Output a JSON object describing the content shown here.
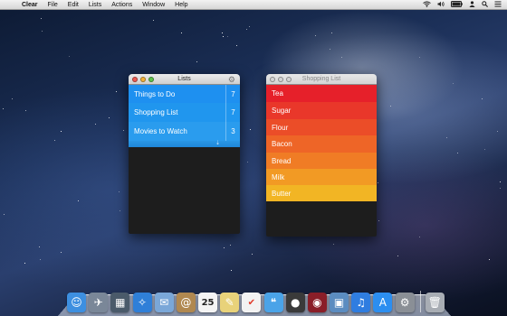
{
  "menubar": {
    "apple_icon": "apple-icon",
    "app_name": "Clear",
    "menus": [
      "File",
      "Edit",
      "Lists",
      "Actions",
      "Window",
      "Help"
    ],
    "status_icons": [
      "wifi-icon",
      "volume-icon",
      "battery-icon",
      "user-icon",
      "search-icon",
      "list-icon"
    ]
  },
  "lists_window": {
    "title": "Lists",
    "items": [
      {
        "label": "Things to Do",
        "count": "7",
        "color": "#1e90f0"
      },
      {
        "label": "Shopping List",
        "count": "7",
        "color": "#2096ee"
      },
      {
        "label": "Movies to Watch",
        "count": "3",
        "color": "#2a9cee"
      }
    ]
  },
  "shopping_window": {
    "title": "Shopping List",
    "items": [
      {
        "label": "Tea",
        "color": "#e6202a"
      },
      {
        "label": "Sugar",
        "color": "#e9372a"
      },
      {
        "label": "Flour",
        "color": "#eb4d28"
      },
      {
        "label": "Bacon",
        "color": "#ee6527"
      },
      {
        "label": "Bread",
        "color": "#f07c25"
      },
      {
        "label": "Milk",
        "color": "#f29a24"
      },
      {
        "label": "Butter",
        "color": "#f2b524"
      }
    ]
  },
  "dock": {
    "icons": [
      {
        "name": "finder-icon",
        "glyph": "☺",
        "color": "#3d8fe0"
      },
      {
        "name": "launchpad-icon",
        "glyph": "✈",
        "color": "#7a8798"
      },
      {
        "name": "mission-control-icon",
        "glyph": "▦",
        "color": "#4a5a6a"
      },
      {
        "name": "safari-icon",
        "glyph": "✧",
        "color": "#2f7fd8"
      },
      {
        "name": "mail-icon",
        "glyph": "✉",
        "color": "#7aa7d8"
      },
      {
        "name": "contacts-icon",
        "glyph": "@",
        "color": "#b08850"
      },
      {
        "name": "calendar-icon",
        "glyph": "25",
        "color": "#f4f4f4"
      },
      {
        "name": "notes-icon",
        "glyph": "✎",
        "color": "#e8d27a"
      },
      {
        "name": "reminders-icon",
        "glyph": "✔",
        "color": "#f2f2f2"
      },
      {
        "name": "messages-icon",
        "glyph": "❝",
        "color": "#4aa3e8"
      },
      {
        "name": "facetime-icon",
        "glyph": "●",
        "color": "#3a3a3a"
      },
      {
        "name": "photo-booth-icon",
        "glyph": "◉",
        "color": "#8a1e28"
      },
      {
        "name": "iphoto-icon",
        "glyph": "▣",
        "color": "#5b8cc0"
      },
      {
        "name": "itunes-icon",
        "glyph": "♫",
        "color": "#2f7de0"
      },
      {
        "name": "app-store-icon",
        "glyph": "A",
        "color": "#2c8ef0"
      },
      {
        "name": "system-preferences-icon",
        "glyph": "⚙",
        "color": "#8a8f96"
      },
      {
        "name": "trash-icon",
        "glyph": "🗑",
        "color": "#a8adb4"
      }
    ]
  }
}
